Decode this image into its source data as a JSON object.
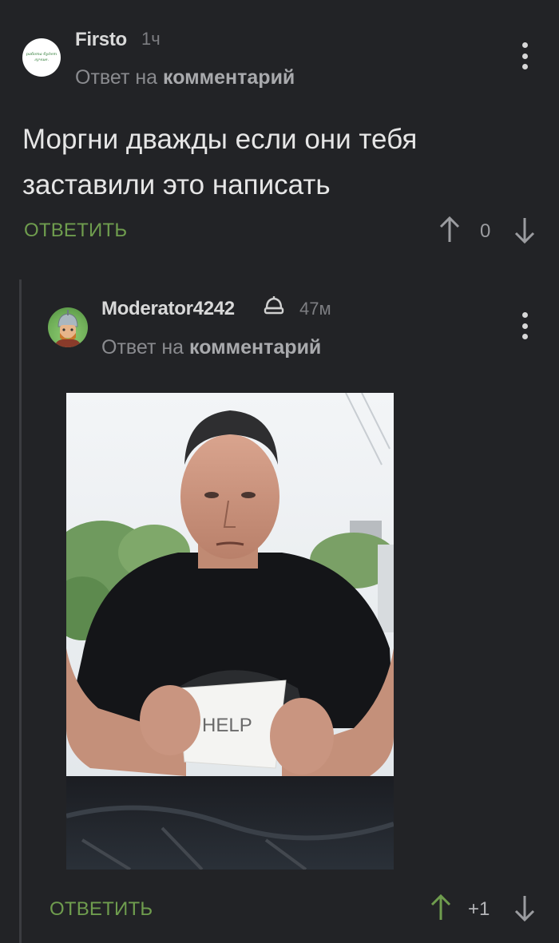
{
  "comment1": {
    "username": "Firsto",
    "time": "1ч",
    "reply_prefix": "Ответ на",
    "reply_target": "комментарий",
    "text_line1": "Моргни дважды если они тебя",
    "text_line2": "заставили это написать",
    "reply_label": "ОТВЕТИТЬ",
    "votes": "0",
    "avatar_text": [
      "работа будет",
      "лучше."
    ],
    "upvote_icon": "arrow-up-icon",
    "downvote_icon": "arrow-down-icon",
    "menu_icon": "more-vertical-icon"
  },
  "comment2": {
    "username": "Moderator4242",
    "badge_icon": "moderator-helmet-icon",
    "time": "47м",
    "reply_prefix": "Ответ на",
    "reply_target": "комментарий",
    "image_note_text": "HELP",
    "reply_label": "ОТВЕТИТЬ",
    "votes": "+1",
    "upvote_active_color": "#6f9d4e",
    "upvote_icon": "arrow-up-icon",
    "downvote_icon": "arrow-down-icon",
    "menu_icon": "more-vertical-icon"
  },
  "colors": {
    "background": "#222326",
    "accent": "#6f9d4e",
    "muted_text": "#8a8b8f"
  }
}
